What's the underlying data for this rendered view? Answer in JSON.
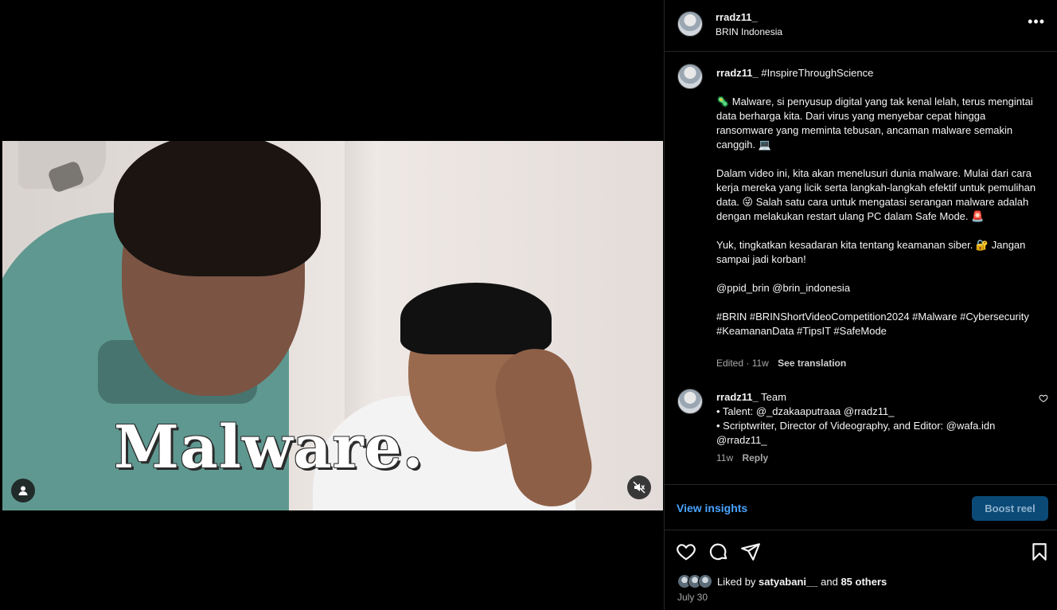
{
  "video": {
    "overlay_text": "Malware."
  },
  "post": {
    "username": "rradz11_",
    "location": "BRIN Indonesia"
  },
  "caption": {
    "username": "rradz11_",
    "hashtag_title": "#InspireThroughScience",
    "paragraphs": [
      "🦠 Malware, si penyusup digital yang tak kenal lelah, terus mengintai data berharga kita. Dari virus yang menyebar cepat hingga ransomware yang meminta tebusan, ancaman malware semakin canggih. 💻",
      "Dalam video ini, kita akan menelusuri dunia malware. Mulai dari cara kerja mereka yang licik serta langkah-langkah efektif untuk pemulihan data. 😜 Salah satu cara untuk mengatasi serangan malware adalah dengan melakukan restart ulang PC dalam Safe Mode. 🚨",
      "Yuk, tingkatkan kesadaran kita tentang keamanan siber. 🔐 Jangan sampai jadi korban!",
      "@ppid_brin @brin_indonesia",
      "#BRIN #BRINShortVideoCompetition2024 #Malware #Cybersecurity #KeamananData #TipsIT #SafeMode"
    ],
    "edited": "Edited · 11w",
    "see_translation": "See translation"
  },
  "comment": {
    "username": "rradz11_",
    "lines": [
      "Team",
      "• Talent: @_dzakaaputraaa @rradz11_",
      "• Scriptwriter, Director of Videography, and Editor: @wafa.idn @rradz11_"
    ],
    "time": "11w",
    "reply": "Reply"
  },
  "actions": {
    "insights": "View insights",
    "boost": "Boost reel"
  },
  "likes": {
    "prefix": "Liked by",
    "first_user": "satyabani__",
    "and": "and",
    "others": "85 others"
  },
  "date": "July 30"
}
